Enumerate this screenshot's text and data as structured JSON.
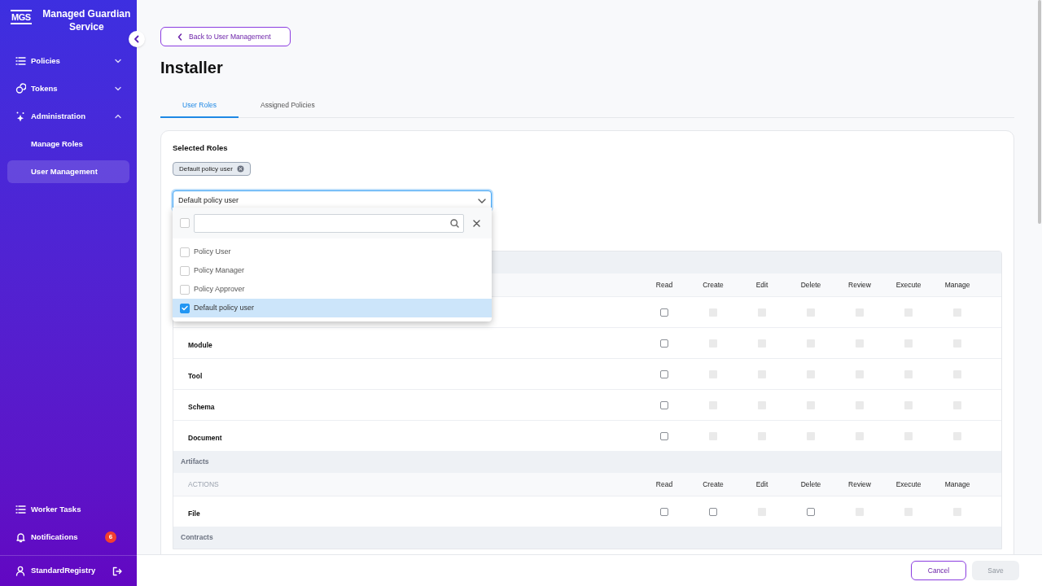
{
  "sidebar": {
    "logo": "MGS",
    "title": "Managed Guardian Service",
    "nav": [
      {
        "label": "Policies",
        "expanded": false
      },
      {
        "label": "Tokens",
        "expanded": false
      },
      {
        "label": "Administration",
        "expanded": true,
        "children": [
          {
            "label": "Manage Roles",
            "selected": false
          },
          {
            "label": "User Management",
            "selected": true
          }
        ]
      }
    ],
    "bottom": [
      {
        "label": "Worker Tasks"
      },
      {
        "label": "Notifications",
        "badge": "6"
      }
    ],
    "user": "StandardRegistry"
  },
  "back_button": "Back to User Management",
  "title": "Installer",
  "tabs": [
    {
      "label": "User Roles",
      "selected": true
    },
    {
      "label": "Assigned Policies",
      "selected": false
    }
  ],
  "selected_roles": {
    "heading": "Selected Roles",
    "chips": [
      "Default policy user"
    ]
  },
  "role_select": {
    "value": "Default policy user",
    "select_all_checked": false,
    "options": [
      {
        "label": "Policy User",
        "checked": false,
        "selected": false
      },
      {
        "label": "Policy Manager",
        "checked": false,
        "selected": false
      },
      {
        "label": "Policy Approver",
        "checked": false,
        "selected": false
      },
      {
        "label": "Default policy user",
        "checked": true,
        "selected": true
      }
    ]
  },
  "permissions": {
    "groups": [
      {
        "columns": [
          "Read",
          "Create",
          "Edit",
          "Delete",
          "Review",
          "Execute",
          "Manage"
        ],
        "rows": [
          {
            "cells": [
              {
                "disabled": false,
                "checked": false
              },
              {
                "disabled": true
              },
              {
                "disabled": true
              },
              {
                "disabled": true
              },
              {
                "disabled": true
              },
              {
                "disabled": true
              },
              {
                "disabled": true
              }
            ]
          },
          {
            "label": "Module",
            "cells": [
              {
                "disabled": false,
                "checked": false
              },
              {
                "disabled": true
              },
              {
                "disabled": true
              },
              {
                "disabled": true
              },
              {
                "disabled": true
              },
              {
                "disabled": true
              },
              {
                "disabled": true
              }
            ]
          },
          {
            "label": "Tool",
            "cells": [
              {
                "disabled": false,
                "checked": false
              },
              {
                "disabled": true
              },
              {
                "disabled": true
              },
              {
                "disabled": true
              },
              {
                "disabled": true
              },
              {
                "disabled": true
              },
              {
                "disabled": true
              }
            ]
          },
          {
            "label": "Schema",
            "cells": [
              {
                "disabled": false,
                "checked": false
              },
              {
                "disabled": true
              },
              {
                "disabled": true
              },
              {
                "disabled": true
              },
              {
                "disabled": true
              },
              {
                "disabled": true
              },
              {
                "disabled": true
              }
            ]
          },
          {
            "label": "Document",
            "cells": [
              {
                "disabled": false,
                "checked": false
              },
              {
                "disabled": true
              },
              {
                "disabled": true
              },
              {
                "disabled": true
              },
              {
                "disabled": true
              },
              {
                "disabled": true
              },
              {
                "disabled": true
              }
            ]
          }
        ]
      },
      {
        "name": "Artifacts",
        "actions_label": "ACTIONS",
        "columns": [
          "Read",
          "Create",
          "Edit",
          "Delete",
          "Review",
          "Execute",
          "Manage"
        ],
        "rows": [
          {
            "label": "File",
            "cells": [
              {
                "disabled": false,
                "checked": false
              },
              {
                "disabled": false,
                "checked": false
              },
              {
                "disabled": true
              },
              {
                "disabled": false,
                "checked": false
              },
              {
                "disabled": true
              },
              {
                "disabled": true
              },
              {
                "disabled": true
              }
            ]
          }
        ]
      },
      {
        "name": "Contracts"
      }
    ]
  },
  "footer": {
    "cancel": "Cancel",
    "save": {
      "label": "Save",
      "disabled": true
    }
  }
}
